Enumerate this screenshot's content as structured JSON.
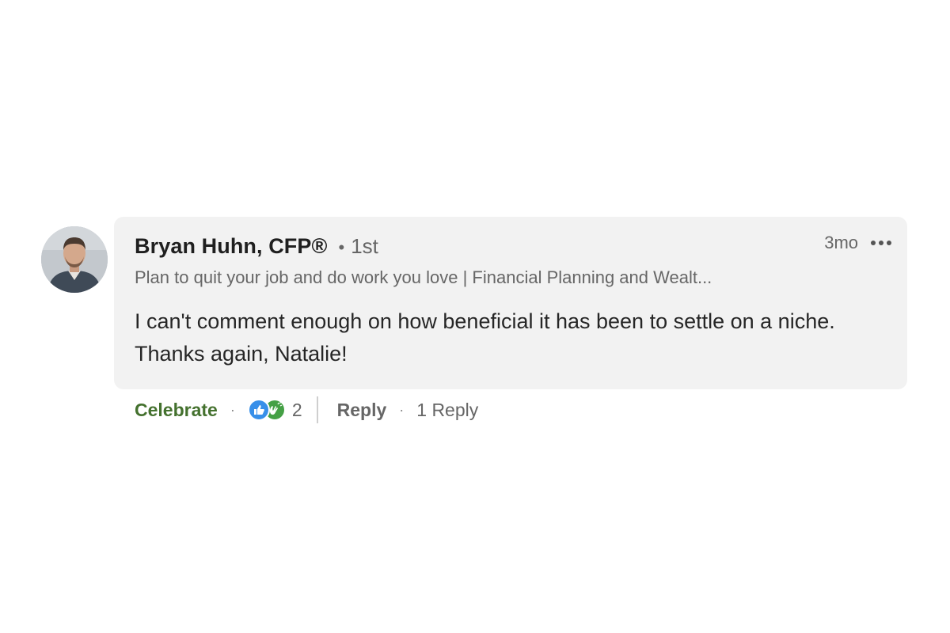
{
  "comment": {
    "author_name": "Bryan Huhn, CFP®",
    "connection_degree": "1st",
    "separator": "•",
    "headline": "Plan to quit your job and do work you love | Financial Planning and Wealt...",
    "timestamp": "3mo",
    "text": "I can't comment enough on how beneficial it has been to settle on a niche. Thanks again, Natalie!"
  },
  "actions": {
    "reaction_label": "Celebrate",
    "dot": "·",
    "reaction_count": "2",
    "reaction_icons": [
      "like-icon",
      "celebrate-icon"
    ],
    "reply_label": "Reply",
    "replies_count_label": "1 Reply"
  },
  "colors": {
    "bubble_bg": "#f2f2f2",
    "celebrate_green": "#44712e",
    "like_blue": "#378fe9",
    "celebrate_icon_green": "#44a045",
    "secondary_text": "#666666"
  }
}
